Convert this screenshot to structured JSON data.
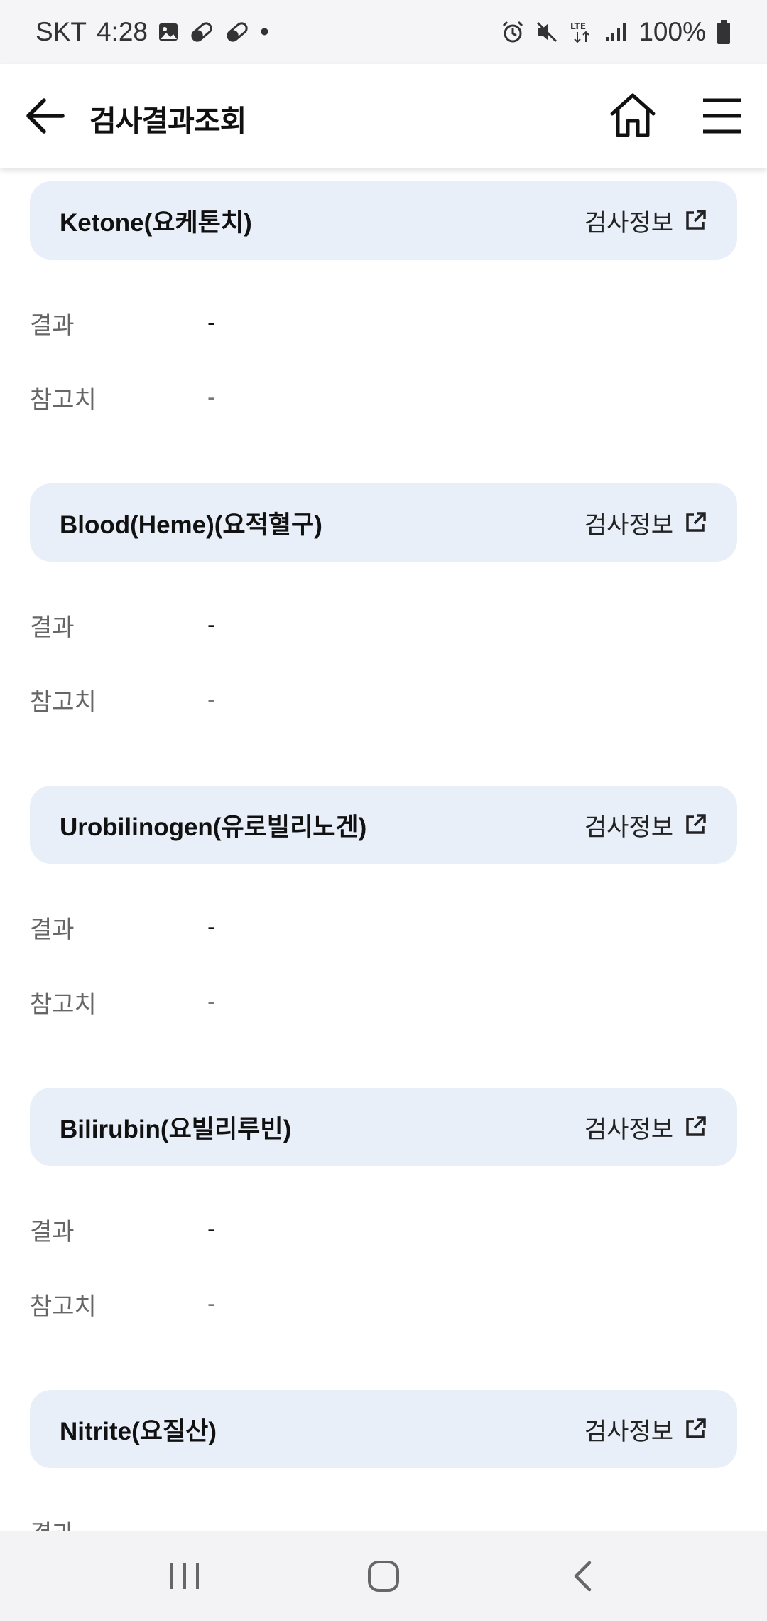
{
  "status_bar": {
    "carrier": "SKT",
    "time": "4:28",
    "dot": "•",
    "network": "LTE",
    "battery": "100%"
  },
  "header": {
    "title": "검사결과조회"
  },
  "tests": [
    {
      "name": "Ketone(요케톤치)",
      "info_label": "검사정보",
      "result_label": "결과",
      "result_value": "-",
      "ref_label": "참고치",
      "ref_value": "-"
    },
    {
      "name": "Blood(Heme)(요적혈구)",
      "info_label": "검사정보",
      "result_label": "결과",
      "result_value": "-",
      "ref_label": "참고치",
      "ref_value": "-"
    },
    {
      "name": "Urobilinogen(유로빌리노겐)",
      "info_label": "검사정보",
      "result_label": "결과",
      "result_value": "-",
      "ref_label": "참고치",
      "ref_value": "-"
    },
    {
      "name": "Bilirubin(요빌리루빈)",
      "info_label": "검사정보",
      "result_label": "결과",
      "result_value": "-",
      "ref_label": "참고치",
      "ref_value": "-"
    },
    {
      "name": "Nitrite(요질산)",
      "info_label": "검사정보",
      "result_label": "결과"
    }
  ],
  "icons": {
    "back": "arrow-left-icon",
    "home": "home-icon",
    "menu": "hamburger-menu-icon",
    "external": "external-link-icon"
  },
  "colors": {
    "card_background": "#e9eff8",
    "status_bar_background": "#f5f5f7",
    "nav_bar_background": "#f3f3f5"
  }
}
